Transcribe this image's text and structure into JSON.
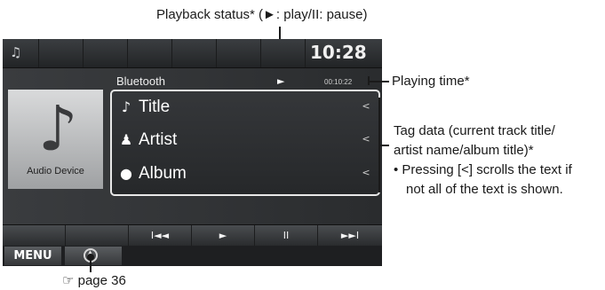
{
  "colors": {
    "screen_bg": "#2b2d30",
    "tag_border": "#e8e8e8",
    "annotation": "#1a1a1a"
  },
  "status_bar": {
    "source_icon": "music-note-icon",
    "clock": "10:28"
  },
  "player": {
    "source": "Bluetooth",
    "playback_indicator": "►",
    "playing_time": "00:10:22",
    "album_art_label": "Audio Device",
    "tags": [
      {
        "icon": "music-note-icon",
        "glyph": "♪",
        "text": "Title",
        "scroll": "<"
      },
      {
        "icon": "person-icon",
        "glyph": "♟",
        "text": "Artist",
        "scroll": "<"
      },
      {
        "icon": "disc-icon",
        "glyph": "●",
        "text": "Album",
        "scroll": "<"
      }
    ]
  },
  "controls": {
    "prev": "I◄◄",
    "play": "►",
    "pause": "II",
    "next": "►►I"
  },
  "bottom": {
    "menu_label": "MENU",
    "eject_icon": "eject-icon"
  },
  "annotations": {
    "playback_status": "Playback status* (►: play/II: pause)",
    "playing_time": "Playing time*",
    "tag_data_1": "Tag data (current track title/",
    "tag_data_2": "artist name/album title)*",
    "tag_note_1": "•  Pressing [<] scrolls the text if",
    "tag_note_2": "not all of the text is shown.",
    "page_ref": "☞ page 36"
  }
}
